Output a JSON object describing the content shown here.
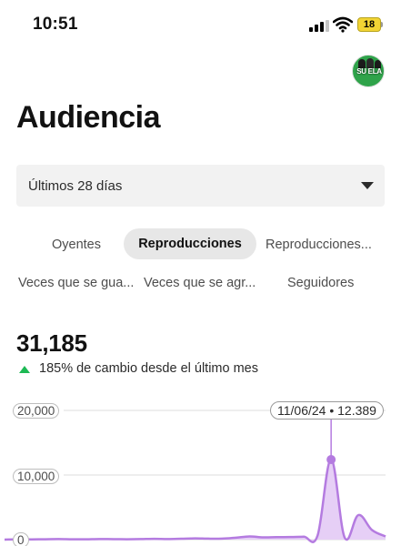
{
  "status_bar": {
    "time": "10:51",
    "battery": "18"
  },
  "header": {
    "avatar_text": "SU ELA"
  },
  "page": {
    "title": "Audiencia"
  },
  "filter": {
    "period_label": "Últimos 28 días"
  },
  "tabs": [
    {
      "label": "Oyentes",
      "selected": false
    },
    {
      "label": "Reproducciones",
      "selected": true
    },
    {
      "label": "Reproducciones...",
      "selected": false
    },
    {
      "label": "Veces que se gua...",
      "selected": false
    },
    {
      "label": "Veces que se agr...",
      "selected": false
    },
    {
      "label": "Seguidores",
      "selected": false
    }
  ],
  "metric": {
    "value": "31,185",
    "change_text": "185% de cambio desde el último mes",
    "trend": "up",
    "trend_color": "#1db954"
  },
  "chart_data": {
    "type": "area",
    "y_tick_labels": [
      "20,000",
      "10,000",
      "0"
    ],
    "ylim": [
      0,
      20000
    ],
    "grid": true,
    "color": "#b47be0",
    "fill": "#e6cff6",
    "tooltip": {
      "date": "11/06/24",
      "value": 12389,
      "label": "11/06/24 • 12.389"
    },
    "values": [
      0,
      50,
      40,
      60,
      80,
      50,
      60,
      90,
      70,
      60,
      80,
      120,
      90,
      140,
      200,
      150,
      160,
      300,
      500,
      350,
      380,
      400,
      450,
      600,
      12389,
      300,
      3800,
      1500,
      500
    ]
  }
}
